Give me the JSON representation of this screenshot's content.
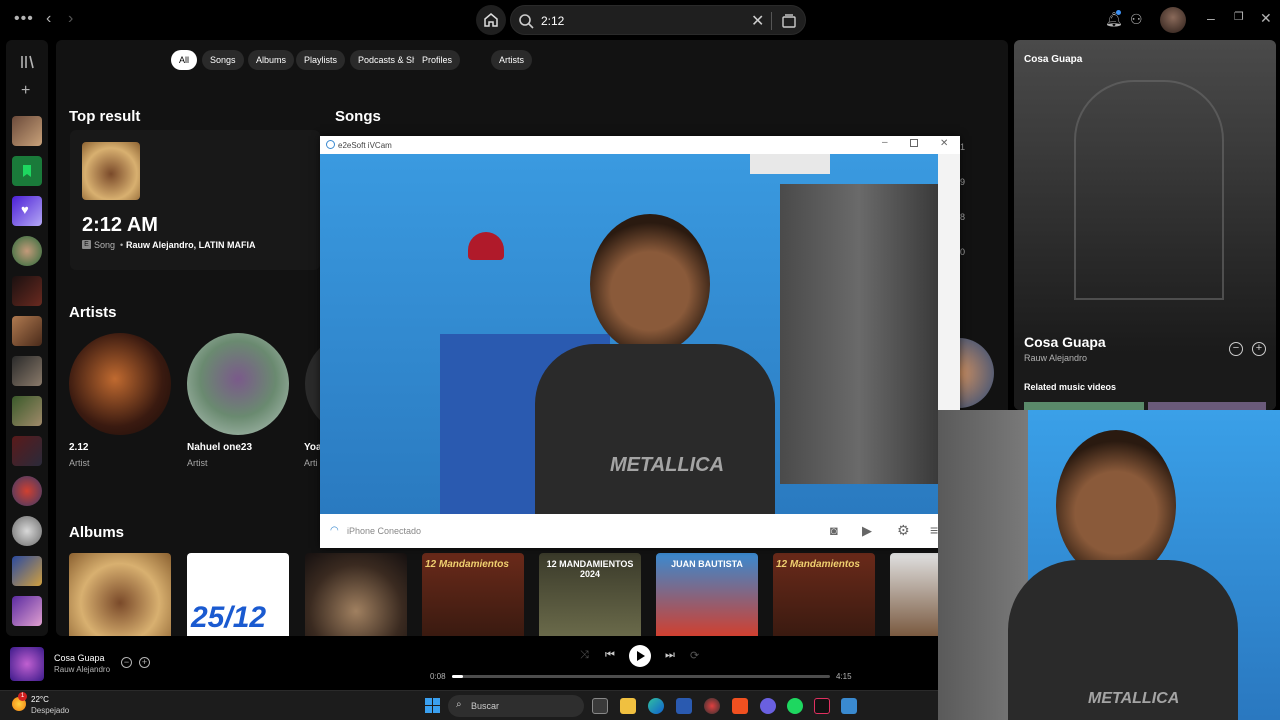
{
  "topbar": {
    "menu_icon": "more-dots-icon",
    "search_value": "2:12"
  },
  "filters": [
    "All",
    "Songs",
    "Albums",
    "Playlists",
    "Podcasts & Shows",
    "Profiles",
    "Artists"
  ],
  "top_result": {
    "heading": "Top result",
    "title": "2:12 AM",
    "type": "Song",
    "artists": "Rauw Alejandro, LATIN MAFIA",
    "explicit": "E"
  },
  "songs": {
    "heading": "Songs",
    "durations_partial": [
      "1",
      "9",
      "8",
      "0"
    ]
  },
  "artists": {
    "heading": "Artists",
    "items": [
      {
        "name": "2.12",
        "sub": "Artist"
      },
      {
        "name": "Nahuel one23",
        "sub": "Artist"
      },
      {
        "name": "Yoa",
        "sub": "Arti"
      }
    ]
  },
  "albums": {
    "heading": "Albums",
    "covers": [
      "",
      "25/12",
      "",
      "12 Mandamientos",
      "12 MANDAMIENTOS 2024",
      "JUAN BAUTISTA",
      "12 Mandamientos",
      ""
    ]
  },
  "right_panel": {
    "header": "Cosa Guapa",
    "title": "Cosa Guapa",
    "artist": "Rauw Alejandro",
    "related": "Related music videos"
  },
  "ivcam": {
    "title": "e2eSoft iVCam",
    "status": "iPhone Conectado"
  },
  "player": {
    "track": "Cosa Guapa",
    "artist": "Rauw Alejandro",
    "elapsed": "0:08",
    "total": "4:15",
    "progress": 0.03
  },
  "taskbar": {
    "weather_temp": "22°C",
    "weather_desc": "Despejado",
    "weather_badge": "1",
    "search_placeholder": "Buscar"
  },
  "colors": {
    "accent": "#1ed760",
    "background": "#121212",
    "video_blue": "#2f8fd0"
  }
}
